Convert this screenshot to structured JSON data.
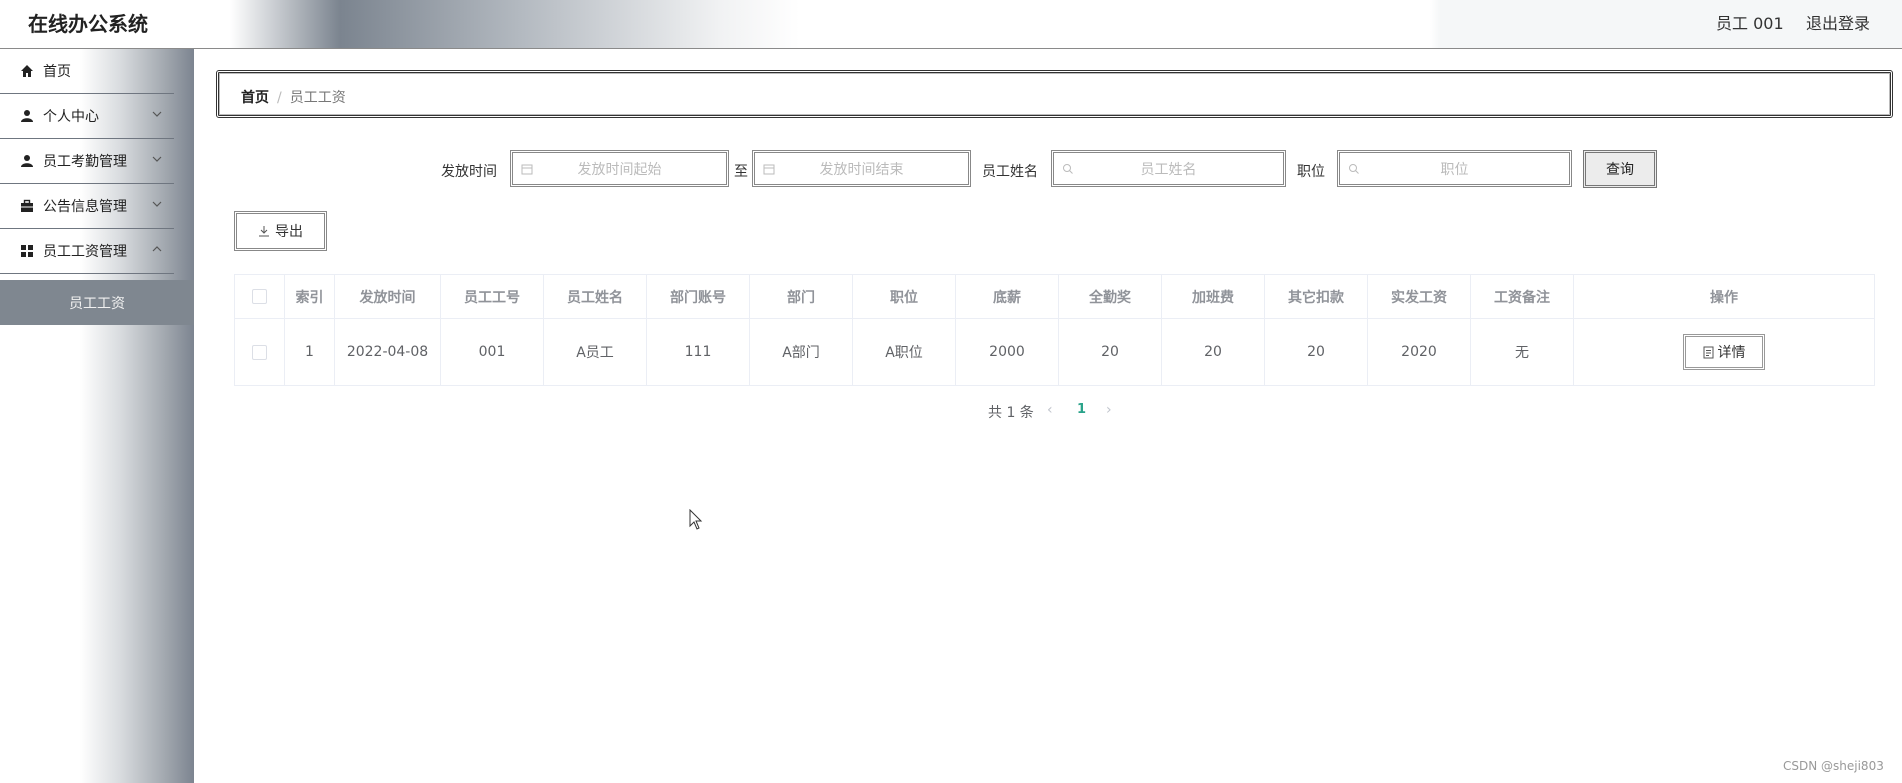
{
  "header": {
    "title": "在线办公系统",
    "user": "员工 001",
    "logout": "退出登录"
  },
  "sidebar": {
    "items": [
      {
        "label": "首页",
        "icon": "home-icon"
      },
      {
        "label": "个人中心",
        "icon": "user-icon"
      },
      {
        "label": "员工考勤管理",
        "icon": "user-icon"
      },
      {
        "label": "公告信息管理",
        "icon": "briefcase-icon"
      },
      {
        "label": "员工工资管理",
        "icon": "grid-icon"
      }
    ],
    "active_sub": "员工工资"
  },
  "breadcrumb": {
    "home": "首页",
    "separator": "/",
    "current": "员工工资"
  },
  "search": {
    "date_label": "发放时间",
    "date_start_placeholder": "发放时间起始",
    "to": "至",
    "date_end_placeholder": "发放时间结束",
    "name_label": "员工姓名",
    "name_placeholder": "员工姓名",
    "position_label": "职位",
    "position_placeholder": "职位",
    "query": "查询"
  },
  "export": "导出",
  "table": {
    "headers": [
      "索引",
      "发放时间",
      "员工工号",
      "员工姓名",
      "部门账号",
      "部门",
      "职位",
      "底薪",
      "全勤奖",
      "加班费",
      "其它扣款",
      "实发工资",
      "工资备注",
      "操作"
    ],
    "rows": [
      [
        "1",
        "2022-04-08",
        "001",
        "A员工",
        "111",
        "A部门",
        "A职位",
        "2000",
        "20",
        "20",
        "20",
        "2020",
        "无"
      ]
    ],
    "detail": "详情"
  },
  "pagination": {
    "total": "共 1 条",
    "current": "1",
    "prev": "‹",
    "next": "›"
  },
  "watermark": "CSDN @sheji803"
}
